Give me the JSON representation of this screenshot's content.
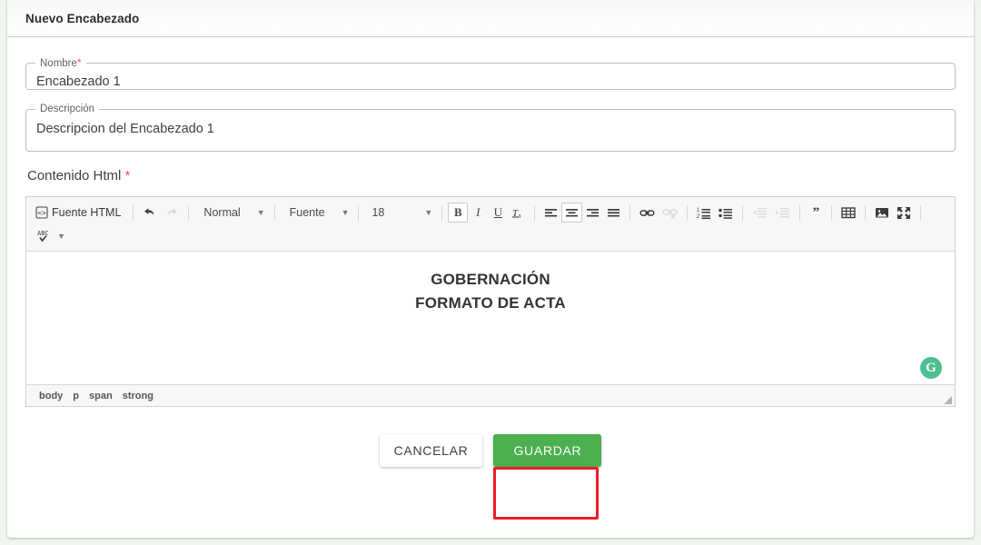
{
  "header": {
    "title": "Nuevo Encabezado"
  },
  "form": {
    "nombre": {
      "label": "Nombre",
      "required_mark": "*",
      "value": "Encabezado 1"
    },
    "descripcion": {
      "label": "Descripción",
      "required_mark": "",
      "value": "Descripcion del Encabezado 1"
    },
    "contenido": {
      "label": "Contenido Html",
      "required_mark": "*"
    }
  },
  "editor": {
    "toolbar": {
      "source_label": "Fuente HTML",
      "source_icon": "html-source-icon",
      "undo_icon": "undo-arrow-icon",
      "redo_icon": "redo-arrow-icon",
      "paragraph_format": "Normal",
      "font_family": "Fuente",
      "font_size": "18",
      "bold_label": "B",
      "italic_label": "I",
      "underline_label": "U",
      "remove_format_label": "Tx",
      "spellcheck_label": "ABC",
      "buttons": [
        {
          "name": "align-left-icon",
          "active": false,
          "disabled": false
        },
        {
          "name": "align-center-icon",
          "active": true,
          "disabled": false
        },
        {
          "name": "align-right-icon",
          "active": false,
          "disabled": false
        },
        {
          "name": "align-justify-icon",
          "active": false,
          "disabled": false
        },
        {
          "name": "link-icon",
          "active": false,
          "disabled": false
        },
        {
          "name": "unlink-icon",
          "active": false,
          "disabled": true
        },
        {
          "name": "numbered-list-icon",
          "active": false,
          "disabled": false
        },
        {
          "name": "bulleted-list-icon",
          "active": false,
          "disabled": false
        },
        {
          "name": "outdent-icon",
          "active": false,
          "disabled": true
        },
        {
          "name": "indent-icon",
          "active": false,
          "disabled": true
        },
        {
          "name": "blockquote-icon",
          "active": false,
          "disabled": false
        },
        {
          "name": "table-icon",
          "active": false,
          "disabled": false
        },
        {
          "name": "image-icon",
          "active": false,
          "disabled": false
        },
        {
          "name": "maximize-icon",
          "active": false,
          "disabled": false
        }
      ]
    },
    "content": {
      "line1": "GOBERNACIÓN",
      "line2": "FORMATO DE ACTA"
    },
    "grammarly_badge": "G",
    "element_path": [
      "body",
      "p",
      "span",
      "strong"
    ]
  },
  "actions": {
    "cancel_label": "CANCELAR",
    "save_label": "GUARDAR"
  },
  "colors": {
    "save_green": "#4caf50",
    "required_red": "#f05545",
    "annotation_red": "#ee1c25",
    "page_background": "#eef6ee",
    "grammarly_green": "#4fc08d"
  }
}
